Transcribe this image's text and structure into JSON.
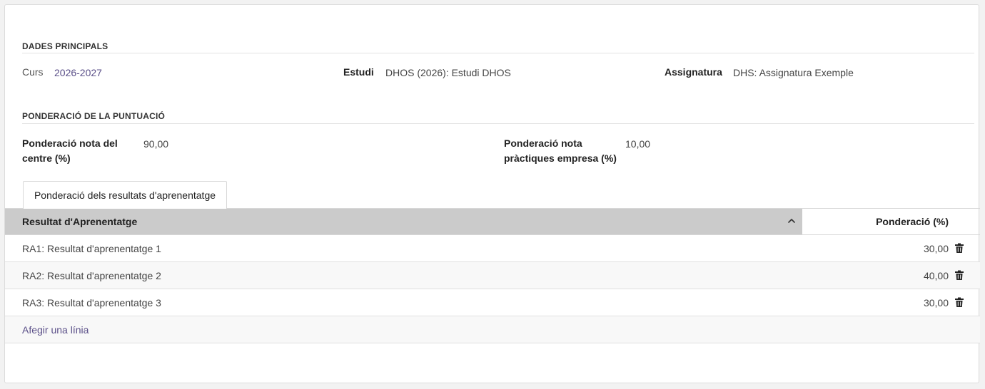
{
  "main_group": {
    "title": "DADES PRINCIPALS",
    "curs_label": "Curs",
    "curs_value": "2026-2027",
    "estudi_label": "Estudi",
    "estudi_value": "DHOS (2026): Estudi DHOS",
    "assignatura_label": "Assignatura",
    "assignatura_value": "DHS: Assignatura Exemple"
  },
  "weight_group": {
    "title": "PONDERACIÓ DE LA PUNTUACIÓ",
    "centre_label_line1": "Ponderació nota del",
    "centre_label_line2": "centre (%)",
    "centre_value": "90,00",
    "empresa_label_line1": "Ponderació nota",
    "empresa_label_line2": "pràctiques empresa (%)",
    "empresa_value": "10,00"
  },
  "tab": {
    "label": "Ponderació dels resultats d'aprenentatge"
  },
  "table": {
    "col_result": "Resultat d'Aprenentatge",
    "col_weight": "Ponderació (%)",
    "rows": [
      {
        "result": "RA1: Resultat d'aprenentatge 1",
        "weight": "30,00"
      },
      {
        "result": "RA2: Resultat d'aprenentatge 2",
        "weight": "40,00"
      },
      {
        "result": "RA3: Resultat d'aprenentatge 3",
        "weight": "30,00"
      }
    ],
    "add_line": "Afegir una línia",
    "sort_icon": "chevron-up-icon",
    "delete_icon": "trash-icon"
  },
  "colors": {
    "link": "#5a4f88",
    "header_active": "#cbcbcb"
  }
}
